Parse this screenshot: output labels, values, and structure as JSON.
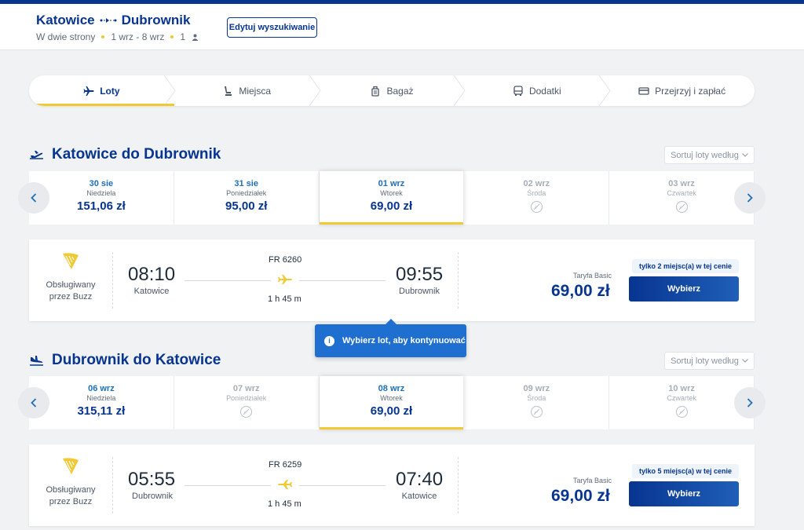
{
  "header": {
    "origin": "Katowice",
    "destination": "Dubrownik",
    "trip_type": "W dwie strony",
    "dates": "1 wrz - 8 wrz",
    "passengers": "1",
    "edit_label": "Edytuj wyszukiwanie"
  },
  "steps": [
    {
      "label": "Loty",
      "icon": "plane-icon",
      "active": true
    },
    {
      "label": "Miejsca",
      "icon": "seat-icon",
      "active": false
    },
    {
      "label": "Bagaż",
      "icon": "luggage-icon",
      "active": false
    },
    {
      "label": "Dodatki",
      "icon": "bus-icon",
      "active": false
    },
    {
      "label": "Przejrzyj i zapłać",
      "icon": "card-icon",
      "active": false
    }
  ],
  "outbound": {
    "title": "Katowice do Dubrownik",
    "sort_label": "Sortuj loty według",
    "dates": [
      {
        "date": "30 sie",
        "weekday": "Niedziela",
        "price": "151,06 zł",
        "available": true,
        "active": false
      },
      {
        "date": "31 sie",
        "weekday": "Poniedziałek",
        "price": "95,00 zł",
        "available": true,
        "active": false
      },
      {
        "date": "01 wrz",
        "weekday": "Wtorek",
        "price": "69,00 zł",
        "available": true,
        "active": true
      },
      {
        "date": "02 wrz",
        "weekday": "Środa",
        "price": "",
        "available": false,
        "active": false
      },
      {
        "date": "03 wrz",
        "weekday": "Czwartek",
        "price": "",
        "available": false,
        "active": false
      }
    ],
    "flight": {
      "operator_line1": "Obsługiwany",
      "operator_line2": "przez Buzz",
      "dep_time": "08:10",
      "dep_city": "Katowice",
      "flight_no": "FR 6260",
      "duration": "1 h 45 m",
      "arr_time": "09:55",
      "arr_city": "Dubrownik",
      "fare_label": "Taryfa Basic",
      "price": "69,00 zł",
      "seats": "tylko 2 miejsc(a) w tej cenie",
      "select_label": "Wybierz"
    }
  },
  "tooltip": "Wybierz lot, aby kontynuować",
  "inbound": {
    "title": "Dubrownik do Katowice",
    "sort_label": "Sortuj loty według",
    "dates": [
      {
        "date": "06 wrz",
        "weekday": "Niedziela",
        "price": "315,11 zł",
        "available": true,
        "active": false
      },
      {
        "date": "07 wrz",
        "weekday": "Poniedziałek",
        "price": "",
        "available": false,
        "active": false
      },
      {
        "date": "08 wrz",
        "weekday": "Wtorek",
        "price": "69,00 zł",
        "available": true,
        "active": true
      },
      {
        "date": "09 wrz",
        "weekday": "Środa",
        "price": "",
        "available": false,
        "active": false
      },
      {
        "date": "10 wrz",
        "weekday": "Czwartek",
        "price": "",
        "available": false,
        "active": false
      }
    ],
    "flight": {
      "operator_line1": "Obsługiwany",
      "operator_line2": "przez Buzz",
      "dep_time": "05:55",
      "dep_city": "Dubrownik",
      "flight_no": "FR 6259",
      "duration": "1 h 45 m",
      "arr_time": "07:40",
      "arr_city": "Katowice",
      "fare_label": "Taryfa Basic",
      "price": "69,00 zł",
      "seats": "tylko 5 miejsc(a) w tej cenie",
      "select_label": "Wybierz"
    }
  },
  "colors": {
    "brand": "#073590",
    "accent": "#f1c933",
    "link": "#1f6fb8"
  }
}
